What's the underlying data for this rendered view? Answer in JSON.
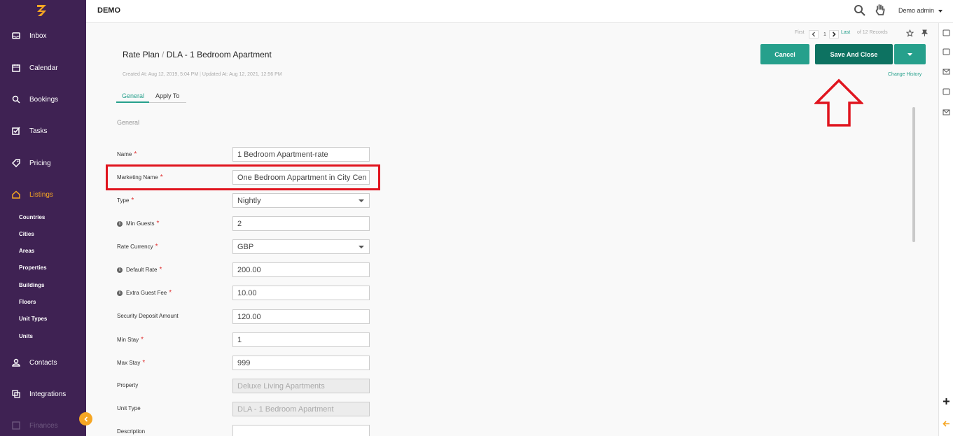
{
  "app": {
    "brand": "DEMO",
    "user": "Demo admin",
    "colors": {
      "sidebar_bg": "#3f2253",
      "accent": "#f6a623",
      "primary": "#26a08c",
      "primary_dark": "#0d7261",
      "required": "#e03030",
      "annotation": "#e0141e"
    }
  },
  "sidebar": {
    "items": [
      {
        "label": "Inbox",
        "icon": "inbox-icon"
      },
      {
        "label": "Calendar",
        "icon": "calendar-icon"
      },
      {
        "label": "Bookings",
        "icon": "bookings-icon"
      },
      {
        "label": "Tasks",
        "icon": "tasks-icon"
      },
      {
        "label": "Pricing",
        "icon": "tag-icon"
      },
      {
        "label": "Listings",
        "icon": "home-icon"
      },
      {
        "label": "Contacts",
        "icon": "user-icon"
      },
      {
        "label": "Integrations",
        "icon": "integrations-icon"
      },
      {
        "label": "Finances",
        "icon": "finances-icon"
      }
    ],
    "active": "Listings",
    "listings_sub": [
      "Countries",
      "Cities",
      "Areas",
      "Properties",
      "Buildings",
      "Floors",
      "Unit Types",
      "Units"
    ]
  },
  "pager": {
    "first": "First",
    "page": "1",
    "last": "Last",
    "records": "of 12 Records"
  },
  "header": {
    "breadcrumb_root": "Rate Plan",
    "breadcrumb_sep": "/",
    "breadcrumb_current": "DLA - 1 Bedroom Apartment",
    "created": "Created At: Aug 12, 2019, 5:04 PM",
    "updated": "Updated At: Aug 12, 2021, 12:56 PM",
    "meta_sep": "|",
    "change_history": "Change History"
  },
  "toolbar": {
    "cancel_label": "Cancel",
    "save_close_label": "Save And Close"
  },
  "tabs": [
    {
      "label": "General",
      "active": true
    },
    {
      "label": "Apply To",
      "active": false
    }
  ],
  "section_title": "General",
  "form": {
    "fields": [
      {
        "label": "Name",
        "required": true,
        "info": false,
        "value": "1 Bedroom Apartment-rate",
        "type": "text"
      },
      {
        "label": "Marketing Name",
        "required": true,
        "info": false,
        "value": "One Bedroom Appartment in City Cen",
        "type": "text"
      },
      {
        "label": "Type",
        "required": true,
        "info": false,
        "value": "Nightly",
        "type": "select"
      },
      {
        "label": "Min Guests",
        "required": true,
        "info": true,
        "value": "2",
        "type": "text"
      },
      {
        "label": "Rate Currency",
        "required": true,
        "info": false,
        "value": "GBP",
        "type": "select"
      },
      {
        "label": "Default Rate",
        "required": true,
        "info": true,
        "value": "200.00",
        "type": "text"
      },
      {
        "label": "Extra Guest Fee",
        "required": true,
        "info": true,
        "value": "10.00",
        "type": "text"
      },
      {
        "label": "Security Deposit Amount",
        "required": false,
        "info": false,
        "value": "120.00",
        "type": "text"
      },
      {
        "label": "Min Stay",
        "required": true,
        "info": false,
        "value": "1",
        "type": "text"
      },
      {
        "label": "Max Stay",
        "required": true,
        "info": false,
        "value": "999",
        "type": "text"
      },
      {
        "label": "Property",
        "required": false,
        "info": false,
        "value": "Deluxe Living Apartments",
        "type": "disabled"
      },
      {
        "label": "Unit Type",
        "required": false,
        "info": false,
        "value": "DLA - 1 Bedroom Apartment",
        "type": "disabled"
      },
      {
        "label": "Description",
        "required": false,
        "info": false,
        "value": "",
        "type": "text"
      }
    ],
    "required_mark": "*",
    "info_mark": "i"
  }
}
